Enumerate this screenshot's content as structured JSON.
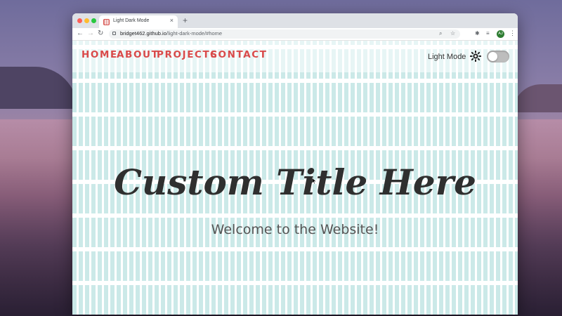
{
  "browser": {
    "tab_title": "Light Dark Mode",
    "tab_close": "×",
    "new_tab": "+",
    "url_host": "bridget462.github.io",
    "url_path": "/light-dark-mode/#home",
    "profile_initials": "AJ"
  },
  "nav": {
    "links": [
      "HOME",
      "ABOUT",
      "PROJECTS",
      "CONTACT"
    ]
  },
  "theme": {
    "mode_label": "Light Mode",
    "toggle_on": false,
    "accent_color": "#d94a4a"
  },
  "hero": {
    "title": "Custom Title Here",
    "subtitle": "Welcome to the Website!"
  }
}
